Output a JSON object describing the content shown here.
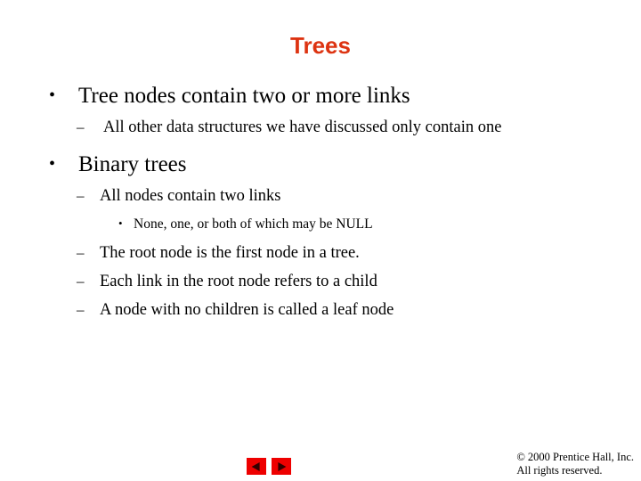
{
  "slide": {
    "title": "Trees",
    "title_color": "#dd3311",
    "background_color": "#ffffff",
    "text_color": "#000000"
  },
  "bullets": [
    {
      "level": 1,
      "marker": "•",
      "text": "Tree nodes contain two or more links"
    },
    {
      "level": 2,
      "marker": "–",
      "text": "All other data structures we have discussed only contain one"
    },
    {
      "level": 1,
      "marker": "•",
      "text": "Binary trees"
    },
    {
      "level": 2,
      "marker": "–",
      "text": "All nodes contain two links"
    },
    {
      "level": 3,
      "marker": "•",
      "text": "None, one, or both of which may be NULL"
    },
    {
      "level": 2,
      "marker": "–",
      "text": "The root node is the first node in a tree."
    },
    {
      "level": 2,
      "marker": "–",
      "text": "Each link in the root node refers to a child"
    },
    {
      "level": 2,
      "marker": "–",
      "text": "A node with no children is called a leaf node"
    }
  ],
  "navigation": {
    "previous_label": "◀",
    "next_label": "▶",
    "button_color": "#ee0000",
    "arrow_color": "#330000",
    "previous_name": "previous-slide",
    "next_name": "next-slide"
  },
  "footer": {
    "copyright_line1": "© 2000 Prentice Hall, Inc.",
    "copyright_line2": "All rights reserved."
  }
}
